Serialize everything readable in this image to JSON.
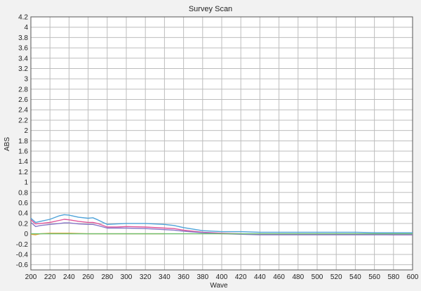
{
  "chart_data": {
    "type": "line",
    "title": "Survey Scan",
    "xlabel": "Wave",
    "ylabel": "ABS",
    "xlim": [
      200,
      600
    ],
    "ylim": [
      -0.7,
      4.2
    ],
    "grid": true,
    "x_ticks": [
      200,
      220,
      240,
      260,
      280,
      300,
      320,
      340,
      360,
      380,
      400,
      420,
      440,
      460,
      480,
      500,
      520,
      540,
      560,
      580,
      600
    ],
    "y_ticks": [
      4.2,
      4,
      3.8,
      3.6,
      3.4,
      3.2,
      3,
      2.8,
      2.6,
      2.4,
      2.2,
      2,
      1.8,
      1.6,
      1.4,
      1.2,
      1,
      0.8,
      0.6,
      0.4,
      0.2,
      0,
      -0.2,
      -0.4,
      -0.6
    ],
    "series": [
      {
        "color": "#4fa3d9",
        "x": [
          200,
          205,
          210,
          220,
          230,
          235,
          240,
          250,
          260,
          265,
          270,
          280,
          290,
          300,
          320,
          340,
          350,
          360,
          380,
          400,
          420,
          440,
          460,
          480,
          500,
          520,
          540,
          560,
          580,
          600
        ],
        "y": [
          0.3,
          0.22,
          0.24,
          0.28,
          0.35,
          0.37,
          0.36,
          0.32,
          0.3,
          0.31,
          0.27,
          0.18,
          0.19,
          0.2,
          0.2,
          0.18,
          0.16,
          0.12,
          0.06,
          0.04,
          0.04,
          0.03,
          0.03,
          0.03,
          0.03,
          0.03,
          0.03,
          0.02,
          0.02,
          0.02
        ]
      },
      {
        "color": "#e0559a",
        "x": [
          200,
          205,
          210,
          220,
          230,
          235,
          240,
          250,
          260,
          265,
          270,
          280,
          290,
          300,
          320,
          340,
          350,
          360,
          380,
          400,
          420,
          440,
          460,
          480,
          500,
          520,
          540,
          560,
          580,
          600
        ],
        "y": [
          0.27,
          0.19,
          0.2,
          0.22,
          0.26,
          0.28,
          0.27,
          0.24,
          0.22,
          0.22,
          0.2,
          0.13,
          0.13,
          0.14,
          0.13,
          0.11,
          0.1,
          0.07,
          0.03,
          0.01,
          0.0,
          -0.01,
          -0.01,
          -0.01,
          -0.01,
          -0.01,
          -0.01,
          -0.01,
          -0.02,
          -0.02
        ]
      },
      {
        "color": "#8a78c8",
        "x": [
          200,
          205,
          210,
          220,
          230,
          235,
          240,
          250,
          260,
          265,
          270,
          280,
          290,
          300,
          320,
          340,
          350,
          360,
          380,
          400,
          420,
          440,
          460,
          480,
          500,
          520,
          540,
          560,
          580,
          600
        ],
        "y": [
          0.22,
          0.14,
          0.16,
          0.18,
          0.2,
          0.21,
          0.21,
          0.19,
          0.18,
          0.18,
          0.16,
          0.11,
          0.11,
          0.11,
          0.1,
          0.08,
          0.07,
          0.05,
          0.02,
          0.0,
          -0.01,
          -0.02,
          -0.02,
          -0.02,
          -0.02,
          -0.02,
          -0.02,
          -0.02,
          -0.02,
          -0.02
        ]
      },
      {
        "color": "#e8a030",
        "x": [
          200,
          205,
          210,
          220,
          240,
          260,
          280,
          300,
          320,
          340
        ],
        "y": [
          -0.01,
          -0.02,
          0.0,
          0.01,
          0.01,
          0.0,
          0.0,
          0.0,
          0.0,
          0.0
        ]
      },
      {
        "color": "#6cc070",
        "x": [
          200,
          220,
          240,
          260,
          280,
          300,
          320,
          340,
          360,
          380,
          400,
          420,
          440,
          460,
          480,
          500,
          520,
          540,
          560,
          580,
          600
        ],
        "y": [
          0.0,
          0.0,
          0.0,
          0.0,
          0.0,
          0.0,
          0.0,
          0.0,
          0.0,
          0.0,
          0.0,
          0.0,
          0.0,
          0.0,
          0.0,
          0.0,
          0.0,
          0.0,
          0.0,
          0.0,
          0.0
        ]
      }
    ]
  }
}
